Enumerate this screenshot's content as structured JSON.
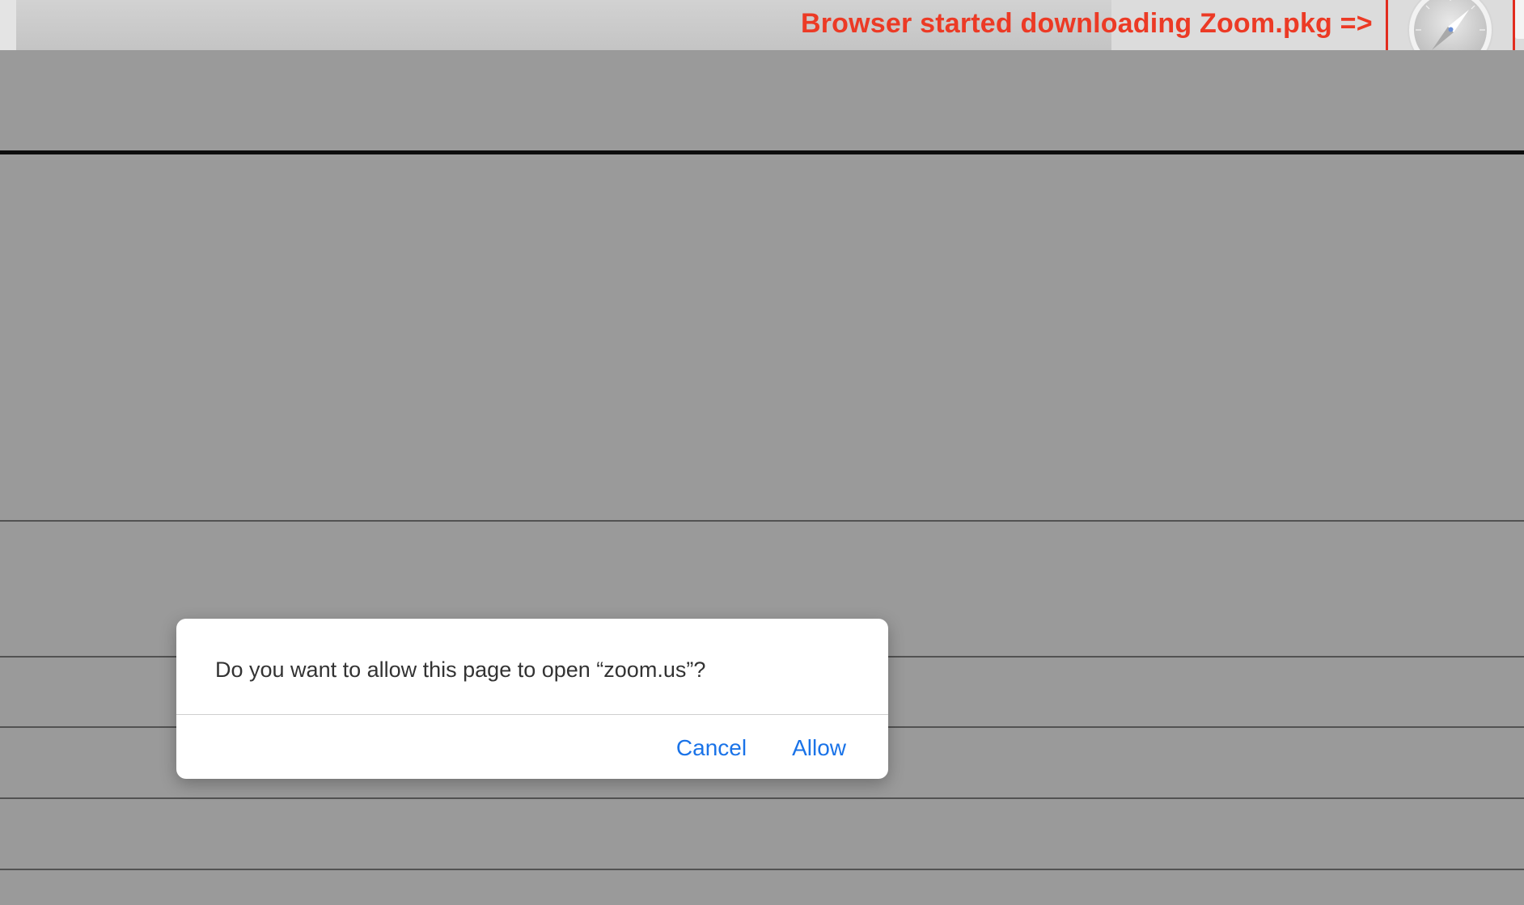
{
  "annotation": {
    "text": "Browser started downloading Zoom.pkg =>",
    "color": "#ec3a25"
  },
  "dock": {
    "highlighted_app_icon": "safari-compass-icon"
  },
  "dialog": {
    "message": "Do you want to allow this page to open “zoom.us”?",
    "cancel_label": "Cancel",
    "allow_label": "Allow",
    "button_color": "#1a73e8"
  }
}
